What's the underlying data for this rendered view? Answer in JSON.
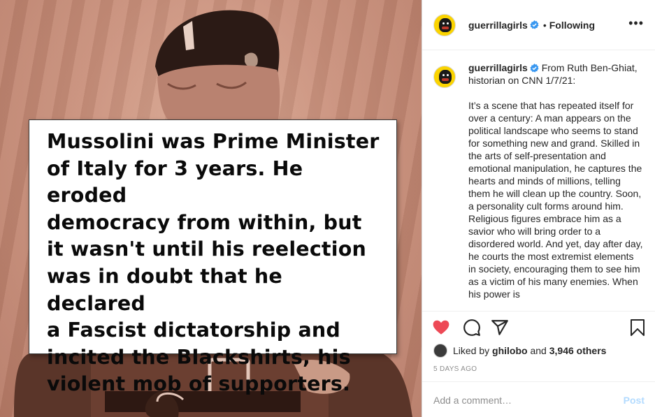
{
  "image": {
    "quote": "Mussolini was Prime Minister\nof Italy for 3 years. He eroded\ndemocracy from within, but\nit wasn't until his reelection\nwas in doubt that he declared\na Fascist dictatorship and\nincited the Blackshirts, his\nviolent mob of supporters."
  },
  "header": {
    "username": "guerrillagirls",
    "separator": "•",
    "follow_status": "Following",
    "more_label": "•••"
  },
  "caption": {
    "username": "guerrillagirls",
    "lead": "From Ruth Ben-Ghiat, historian on CNN 1/7/21:",
    "body": "It’s a scene that has repeated itself for over a century: A man appears on the political landscape who seems to stand for something new and grand. Skilled in the arts of self-presentation and emotional manipulation, he captures the hearts and minds of millions, telling them he will clean up the country. Soon, a personality cult forms around him. Religious figures embrace him as a savior who will bring order to a disordered world. And yet, day after day, he courts the most extremist elements in society, encouraging them to see him as a victim of his many enemies. When his power is"
  },
  "actions": {
    "like_icon": "heart-filled-icon",
    "comment_icon": "comment-icon",
    "share_icon": "paper-plane-icon",
    "save_icon": "bookmark-icon",
    "liked_by_prefix": "Liked by",
    "liked_by_user": "ghilobo",
    "liked_by_and": "and",
    "liked_by_others": "3,946 others",
    "timestamp": "5 DAYS AGO"
  },
  "comment": {
    "placeholder": "Add a comment…",
    "post_label": "Post"
  },
  "colors": {
    "like_red": "#ed4956",
    "verified_blue": "#3897f0",
    "post_disabled": "#b3dbff",
    "photo_tint": "#c98f7a"
  }
}
